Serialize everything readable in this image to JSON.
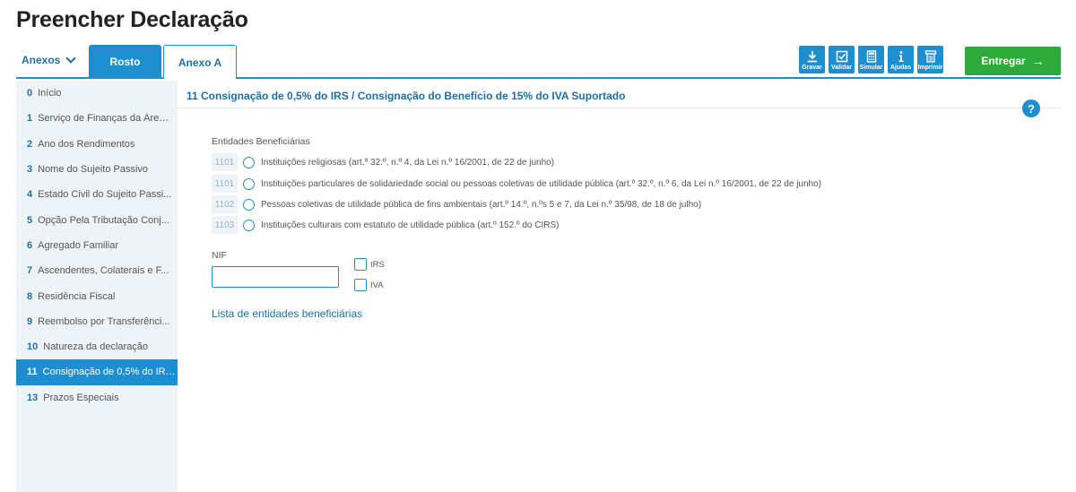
{
  "page": {
    "title": "Preencher Declaração"
  },
  "topbar": {
    "anexos_label": "Anexos",
    "tabs": [
      {
        "label": "Rosto",
        "active": true
      },
      {
        "label": "Anexo A",
        "active": false
      }
    ],
    "tools": [
      {
        "label": "Gravar",
        "icon": "download-icon"
      },
      {
        "label": "Validar",
        "icon": "check-box-icon"
      },
      {
        "label": "Simular",
        "icon": "calculator-icon"
      },
      {
        "label": "Ajudas",
        "icon": "info-icon"
      },
      {
        "label": "Imprimir",
        "icon": "printer-icon"
      }
    ],
    "entregar_label": "Entregar",
    "entregar_arrow": "→"
  },
  "sidebar": {
    "items": [
      {
        "num": "0",
        "label": "Início"
      },
      {
        "num": "1",
        "label": "Serviço de Finanças da Área..."
      },
      {
        "num": "2",
        "label": "Ano dos Rendimentos"
      },
      {
        "num": "3",
        "label": "Nome do Sujeito Passivo"
      },
      {
        "num": "4",
        "label": "Estado Civil do Sujeito Passi..."
      },
      {
        "num": "5",
        "label": "Opção Pela Tributação Conj..."
      },
      {
        "num": "6",
        "label": "Agregado Familiar"
      },
      {
        "num": "7",
        "label": "Ascendentes, Colaterais e F..."
      },
      {
        "num": "8",
        "label": "Residência Fiscal"
      },
      {
        "num": "9",
        "label": "Reembolso por Transferênci..."
      },
      {
        "num": "10",
        "label": "Natureza da declaração"
      },
      {
        "num": "11",
        "label": "Consignação de 0,5% do IRS..."
      },
      {
        "num": "13",
        "label": "Prazos Especiais"
      }
    ],
    "active_index": 11
  },
  "main": {
    "section_title": "11  Consignação de 0,5% do IRS / Consignação do Benefício de 15% do IVA Suportado",
    "help_label": "?",
    "entities_label": "Entidades Beneficiárias",
    "options": [
      {
        "code": "1101",
        "label": "Instituições religiosas (art.º 32.º, n.º 4, da Lei n.º 16/2001, de 22 de junho)"
      },
      {
        "code": "1101",
        "label": "Instituições particulares de solidariedade social ou pessoas coletivas de utilidade pública (art.º 32.º, n.º 6, da Lei n.º 16/2001, de 22 de junho)"
      },
      {
        "code": "1102",
        "label": "Pessoas coletivas de utilidade pública de fins ambientais (art.º 14.º, n.ºs 5 e 7, da Lei n.º 35/98, de 18 de julho)"
      },
      {
        "code": "1103",
        "label": "Instituições culturais com estatuto de utilidade pública (art.º 152.º do CIRS)"
      }
    ],
    "nif_label": "NIF",
    "nif_value": "",
    "checkboxes": [
      {
        "label": "IRS"
      },
      {
        "label": "IVA"
      }
    ],
    "link_label": "Lista de entidades beneficiárias"
  },
  "colors": {
    "accent": "#1d8fd1",
    "link": "#1d6fa8",
    "success": "#2eaa3a",
    "sidebar_bg": "#eef3f8"
  }
}
